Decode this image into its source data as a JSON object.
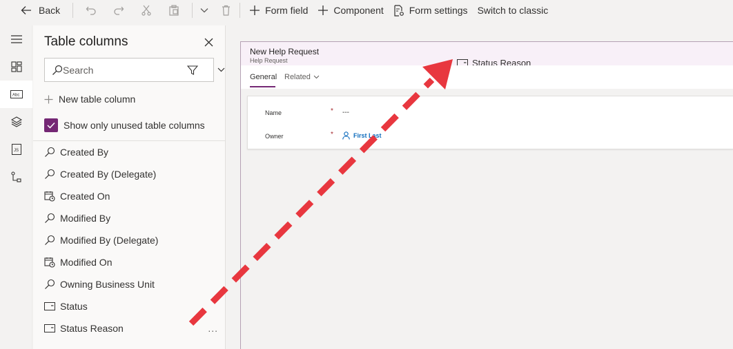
{
  "toolbar": {
    "back_label": "Back",
    "form_field_label": "Form field",
    "component_label": "Component",
    "form_settings_label": "Form settings",
    "switch_classic_label": "Switch to classic"
  },
  "panel": {
    "title": "Table columns",
    "search_placeholder": "Search",
    "new_column_label": "New table column",
    "show_unused_label": "Show only unused table columns",
    "show_unused_checked": true,
    "columns": [
      {
        "label": "Created By",
        "icon": "lookup-icon"
      },
      {
        "label": "Created By (Delegate)",
        "icon": "lookup-icon"
      },
      {
        "label": "Created On",
        "icon": "calendar-clock-icon"
      },
      {
        "label": "Modified By",
        "icon": "lookup-icon"
      },
      {
        "label": "Modified By (Delegate)",
        "icon": "lookup-icon"
      },
      {
        "label": "Modified On",
        "icon": "calendar-clock-icon"
      },
      {
        "label": "Owning Business Unit",
        "icon": "lookup-icon"
      },
      {
        "label": "Status",
        "icon": "option-set-icon"
      },
      {
        "label": "Status Reason",
        "icon": "option-set-icon"
      }
    ],
    "more_label": "..."
  },
  "form": {
    "title": "New Help Request",
    "subtitle": "Help Request",
    "header_field_label": "Status Reason",
    "tabs": [
      {
        "label": "General"
      },
      {
        "label": "Related"
      }
    ],
    "fields": [
      {
        "label": "Name",
        "required": "*",
        "value": "---"
      },
      {
        "label": "Owner",
        "required": "*",
        "value": "First Last"
      }
    ]
  },
  "colors": {
    "accent": "#742774",
    "arrow": "#e8373f",
    "link": "#0f6cbd",
    "required": "#a4262c"
  }
}
